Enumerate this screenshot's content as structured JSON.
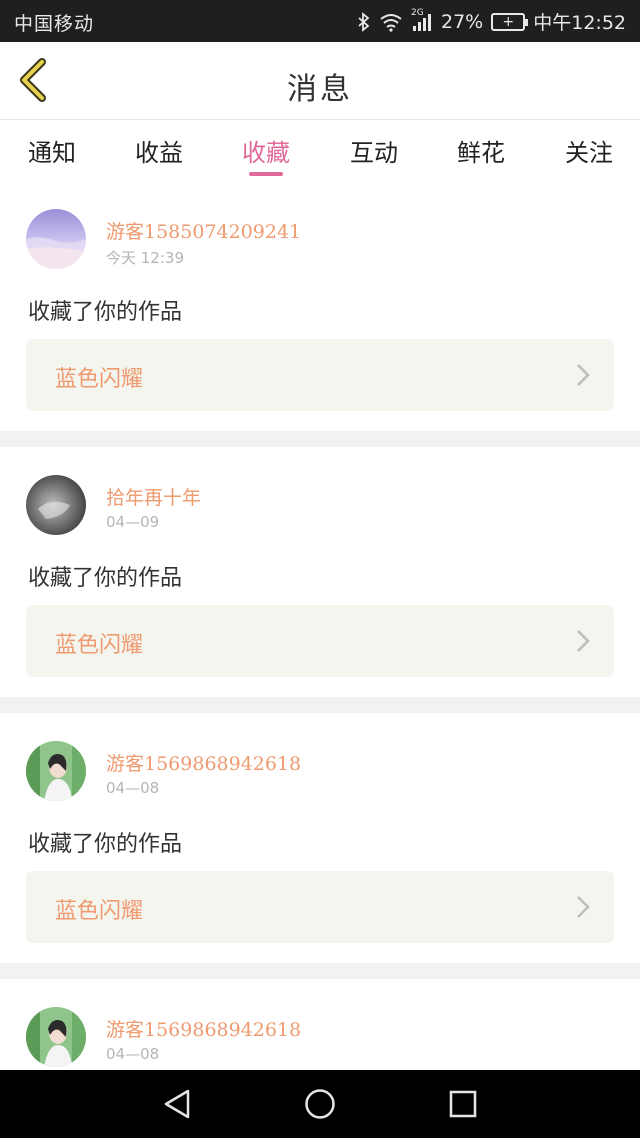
{
  "status_bar": {
    "carrier": "中国移动",
    "network": "2G",
    "battery": "27%",
    "battery_icon_text": "+",
    "time": "中午12:52"
  },
  "header": {
    "title": "消息",
    "back_icon": "back-chevron-icon"
  },
  "tabs": [
    {
      "label": "通知",
      "active": false
    },
    {
      "label": "收益",
      "active": false
    },
    {
      "label": "收藏",
      "active": true
    },
    {
      "label": "互动",
      "active": false
    },
    {
      "label": "鲜花",
      "active": false
    },
    {
      "label": "关注",
      "active": false
    }
  ],
  "colors": {
    "accent": "#e0699a",
    "name_color": "#ef9a6f",
    "box_bg": "#f5f5f0"
  },
  "items": [
    {
      "username": "游客1585074209241",
      "time": "今天 12:39",
      "action": "收藏了你的作品",
      "work_title": "蓝色闪耀",
      "avatar": "sky-sea-avatar"
    },
    {
      "username": "拾年再十年",
      "time": "04—09",
      "action": "收藏了你的作品",
      "work_title": "蓝色闪耀",
      "avatar": "grayscale-avatar"
    },
    {
      "username": "游客1569868942618",
      "time": "04—08",
      "action": "收藏了你的作品",
      "work_title": "蓝色闪耀",
      "avatar": "girl-green-avatar"
    },
    {
      "username": "游客1569868942618",
      "time": "04—08"
    }
  ],
  "nav_bar": {
    "back": "nav-back-icon",
    "home": "nav-home-icon",
    "recents": "nav-recents-icon"
  }
}
